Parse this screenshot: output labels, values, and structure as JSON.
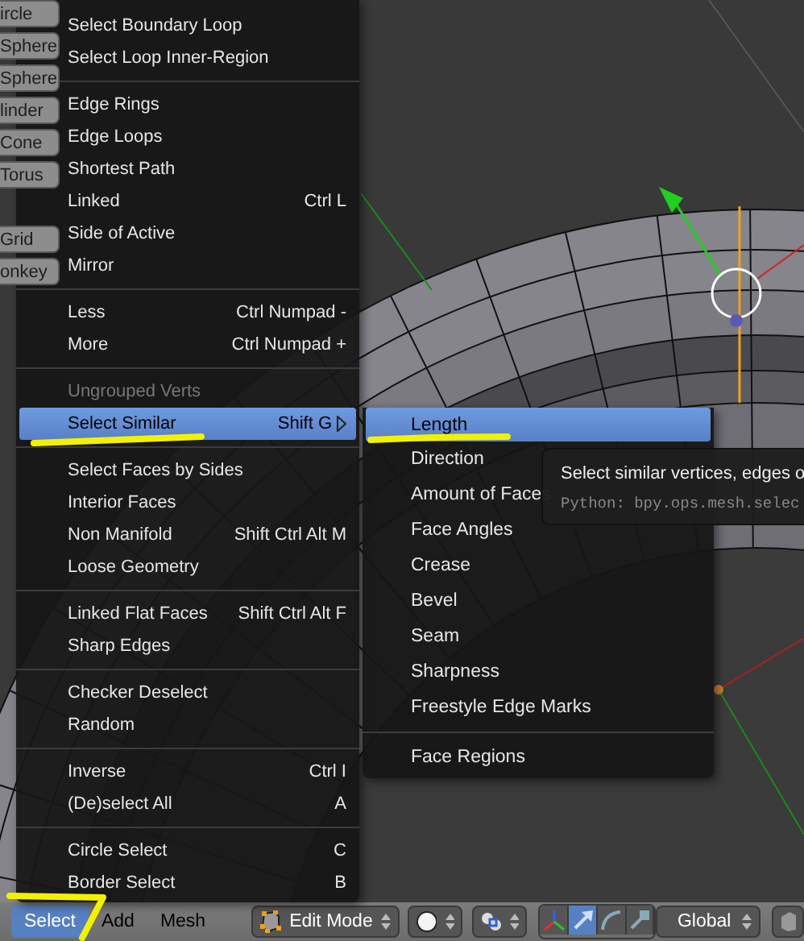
{
  "toolshelf": {
    "groups": [
      [
        "ircle",
        "Sphere",
        "Sphere",
        "linder",
        "Cone",
        "Torus"
      ],
      [
        "Grid",
        "onkey"
      ]
    ]
  },
  "select_menu": {
    "groups": [
      [
        {
          "label": "Select Boundary Loop",
          "disabled": false,
          "selected": false,
          "submenu": false
        },
        {
          "label": "Select Loop Inner-Region",
          "disabled": false,
          "selected": false,
          "submenu": false
        }
      ],
      [
        {
          "label": "Edge Rings",
          "disabled": false,
          "selected": false,
          "submenu": false
        },
        {
          "label": "Edge Loops",
          "disabled": false,
          "selected": false,
          "submenu": false
        },
        {
          "label": "Shortest Path",
          "disabled": false,
          "selected": false,
          "submenu": false
        },
        {
          "label": "Linked",
          "shortcut": "Ctrl L",
          "disabled": false,
          "selected": false,
          "submenu": false
        },
        {
          "label": "Side of Active",
          "disabled": false,
          "selected": false,
          "submenu": false
        },
        {
          "label": "Mirror",
          "disabled": false,
          "selected": false,
          "submenu": false
        }
      ],
      [
        {
          "label": "Less",
          "shortcut": "Ctrl Numpad -",
          "disabled": false,
          "selected": false,
          "submenu": false
        },
        {
          "label": "More",
          "shortcut": "Ctrl Numpad +",
          "disabled": false,
          "selected": false,
          "submenu": false
        }
      ],
      [
        {
          "label": "Ungrouped Verts",
          "disabled": true,
          "selected": false,
          "submenu": false
        },
        {
          "label": "Select Similar",
          "shortcut": "Shift G",
          "disabled": false,
          "selected": true,
          "submenu": true
        }
      ],
      [
        {
          "label": "Select Faces by Sides",
          "disabled": false,
          "selected": false,
          "submenu": false
        },
        {
          "label": "Interior Faces",
          "disabled": false,
          "selected": false,
          "submenu": false
        },
        {
          "label": "Non Manifold",
          "shortcut": "Shift Ctrl Alt M",
          "disabled": false,
          "selected": false,
          "submenu": false
        },
        {
          "label": "Loose Geometry",
          "disabled": false,
          "selected": false,
          "submenu": false
        }
      ],
      [
        {
          "label": "Linked Flat Faces",
          "shortcut": "Shift Ctrl Alt F",
          "disabled": false,
          "selected": false,
          "submenu": false
        },
        {
          "label": "Sharp Edges",
          "disabled": false,
          "selected": false,
          "submenu": false
        }
      ],
      [
        {
          "label": "Checker Deselect",
          "disabled": false,
          "selected": false,
          "submenu": false
        },
        {
          "label": "Random",
          "disabled": false,
          "selected": false,
          "submenu": false
        }
      ],
      [
        {
          "label": "Inverse",
          "shortcut": "Ctrl I",
          "disabled": false,
          "selected": false,
          "submenu": false
        },
        {
          "label": "(De)select All",
          "shortcut": "A",
          "disabled": false,
          "selected": false,
          "submenu": false
        }
      ],
      [
        {
          "label": "Circle Select",
          "shortcut": "C",
          "disabled": false,
          "selected": false,
          "submenu": false
        },
        {
          "label": "Border Select",
          "shortcut": "B",
          "disabled": false,
          "selected": false,
          "submenu": false
        }
      ]
    ]
  },
  "similar_submenu": {
    "groups": [
      [
        {
          "label": "Length",
          "selected": true
        },
        {
          "label": "Direction",
          "selected": false
        },
        {
          "label": "Amount of Faces",
          "selected": false
        },
        {
          "label": "Face Angles",
          "selected": false
        },
        {
          "label": "Crease",
          "selected": false
        },
        {
          "label": "Bevel",
          "selected": false
        },
        {
          "label": "Seam",
          "selected": false
        },
        {
          "label": "Sharpness",
          "selected": false
        },
        {
          "label": "Freestyle Edge Marks",
          "selected": false
        }
      ],
      [
        {
          "label": "Face Regions",
          "selected": false
        }
      ]
    ]
  },
  "tooltip": {
    "description": "Select similar vertices, edges o",
    "python": "Python: bpy.ops.mesh.selec"
  },
  "header": {
    "menus": [
      {
        "label": "Select",
        "selected": true
      },
      {
        "label": "Add",
        "selected": false
      },
      {
        "label": "Mesh",
        "selected": false
      }
    ],
    "mode_dropdown": {
      "value": "Edit Mode"
    },
    "manipulators": [
      {
        "kind": "axes",
        "selected": false
      },
      {
        "kind": "translate",
        "selected": true
      },
      {
        "kind": "rotate",
        "selected": false
      },
      {
        "kind": "scale",
        "selected": false
      }
    ],
    "orientation_dropdown": {
      "value": "Global"
    }
  }
}
